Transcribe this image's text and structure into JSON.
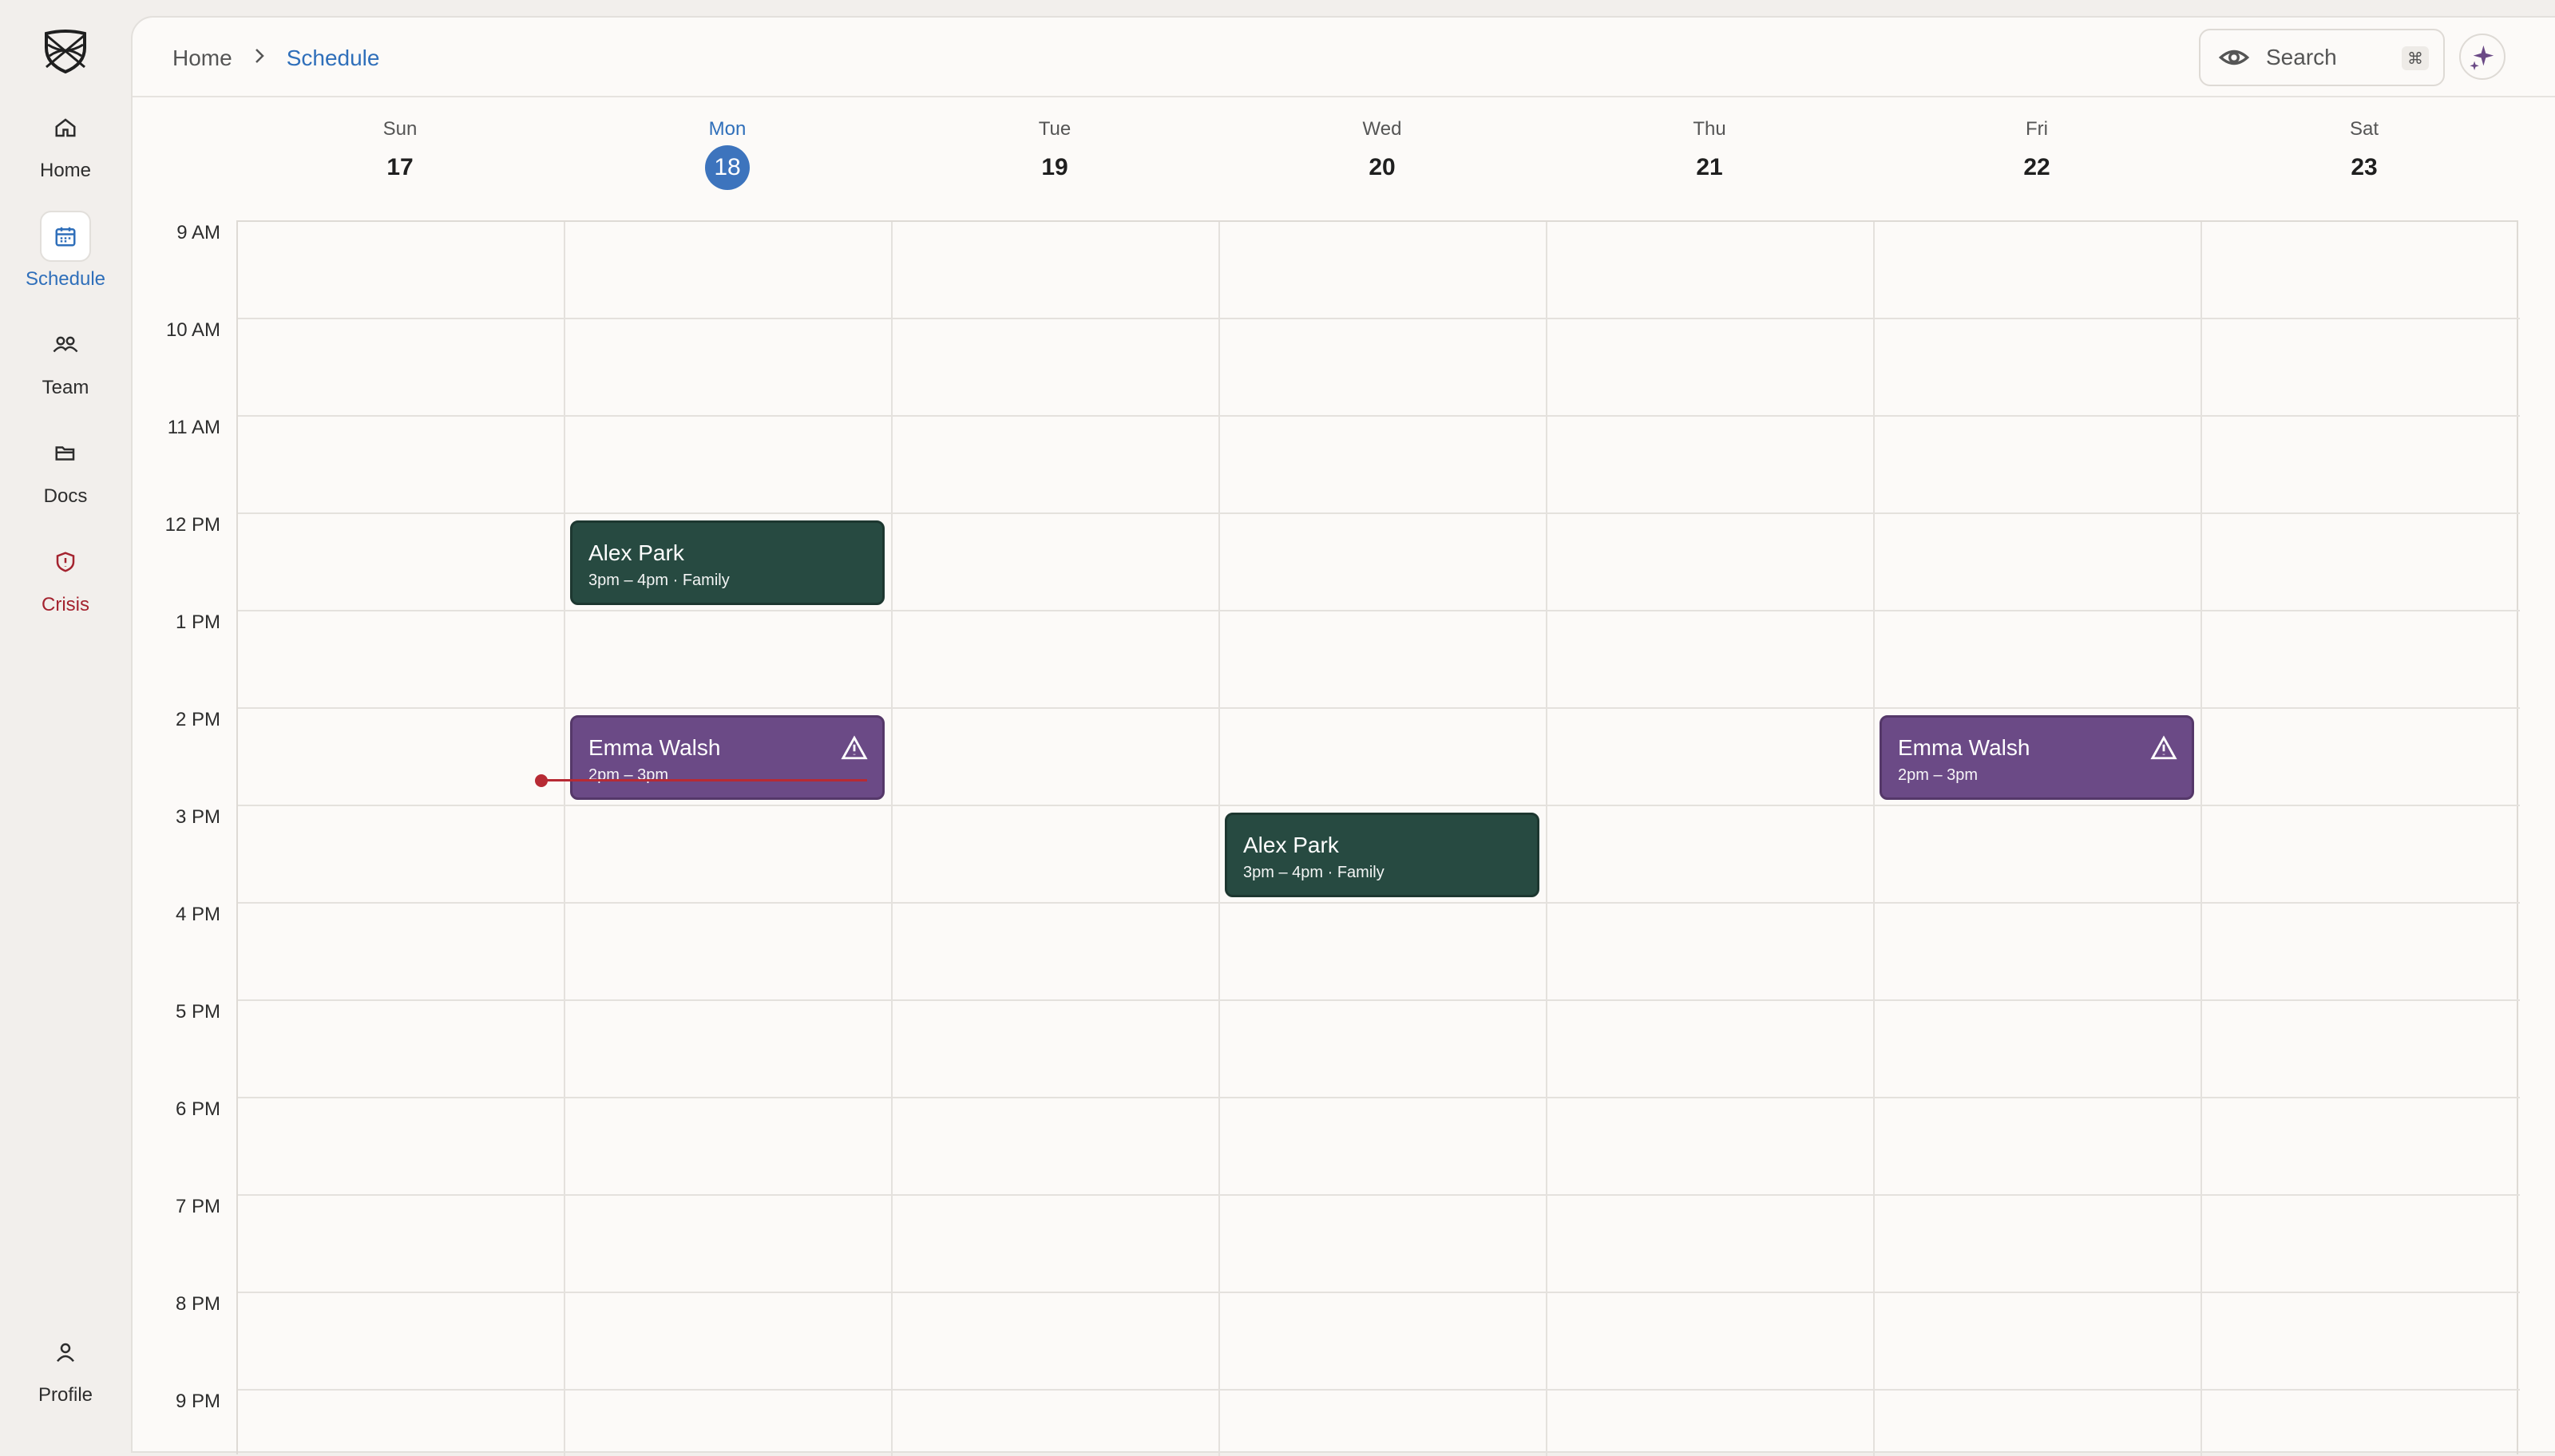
{
  "sidebar": {
    "items": [
      {
        "label": "Home",
        "icon": "home-icon"
      },
      {
        "label": "Schedule",
        "icon": "calendar-icon",
        "active": true
      },
      {
        "label": "Team",
        "icon": "team-icon"
      },
      {
        "label": "Docs",
        "icon": "folder-icon"
      },
      {
        "label": "Crisis",
        "icon": "shield-alert-icon"
      }
    ],
    "profile_label": "Profile"
  },
  "header": {
    "breadcrumb_home": "Home",
    "breadcrumb_current": "Schedule",
    "search_label": "Search",
    "search_shortcut": "⌘"
  },
  "calendar": {
    "days": [
      {
        "name": "Sun",
        "num": "17"
      },
      {
        "name": "Mon",
        "num": "18",
        "today": true
      },
      {
        "name": "Tue",
        "num": "19"
      },
      {
        "name": "Wed",
        "num": "20"
      },
      {
        "name": "Thu",
        "num": "21"
      },
      {
        "name": "Fri",
        "num": "22"
      },
      {
        "name": "Sat",
        "num": "23"
      }
    ],
    "hours": [
      "9 AM",
      "10 AM",
      "11 AM",
      "12 PM",
      "1 PM",
      "2 PM",
      "3 PM",
      "4 PM",
      "5 PM",
      "6 PM",
      "7 PM",
      "8 PM",
      "9 PM"
    ],
    "events": [
      {
        "title": "Alex Park",
        "subtitle": "3pm – 4pm · Family",
        "color": "#274a41",
        "day": "Mon",
        "start": "12 PM",
        "alert": false
      },
      {
        "title": "Emma Walsh",
        "subtitle": "2pm – 3pm",
        "color": "#6b4a86",
        "day": "Mon",
        "start": "2 PM",
        "alert": true
      },
      {
        "title": "Alex Park",
        "subtitle": "3pm – 4pm · Family",
        "color": "#274a41",
        "day": "Wed",
        "start": "3 PM",
        "alert": false
      },
      {
        "title": "Emma Walsh",
        "subtitle": "2pm – 3pm",
        "color": "#6b4a86",
        "day": "Fri",
        "start": "2 PM",
        "alert": true
      }
    ],
    "current_time_color": "#b72a34"
  },
  "colors": {
    "accent": "#2f6fba",
    "today_badge": "#3d74bd",
    "crisis": "#a4232f"
  }
}
